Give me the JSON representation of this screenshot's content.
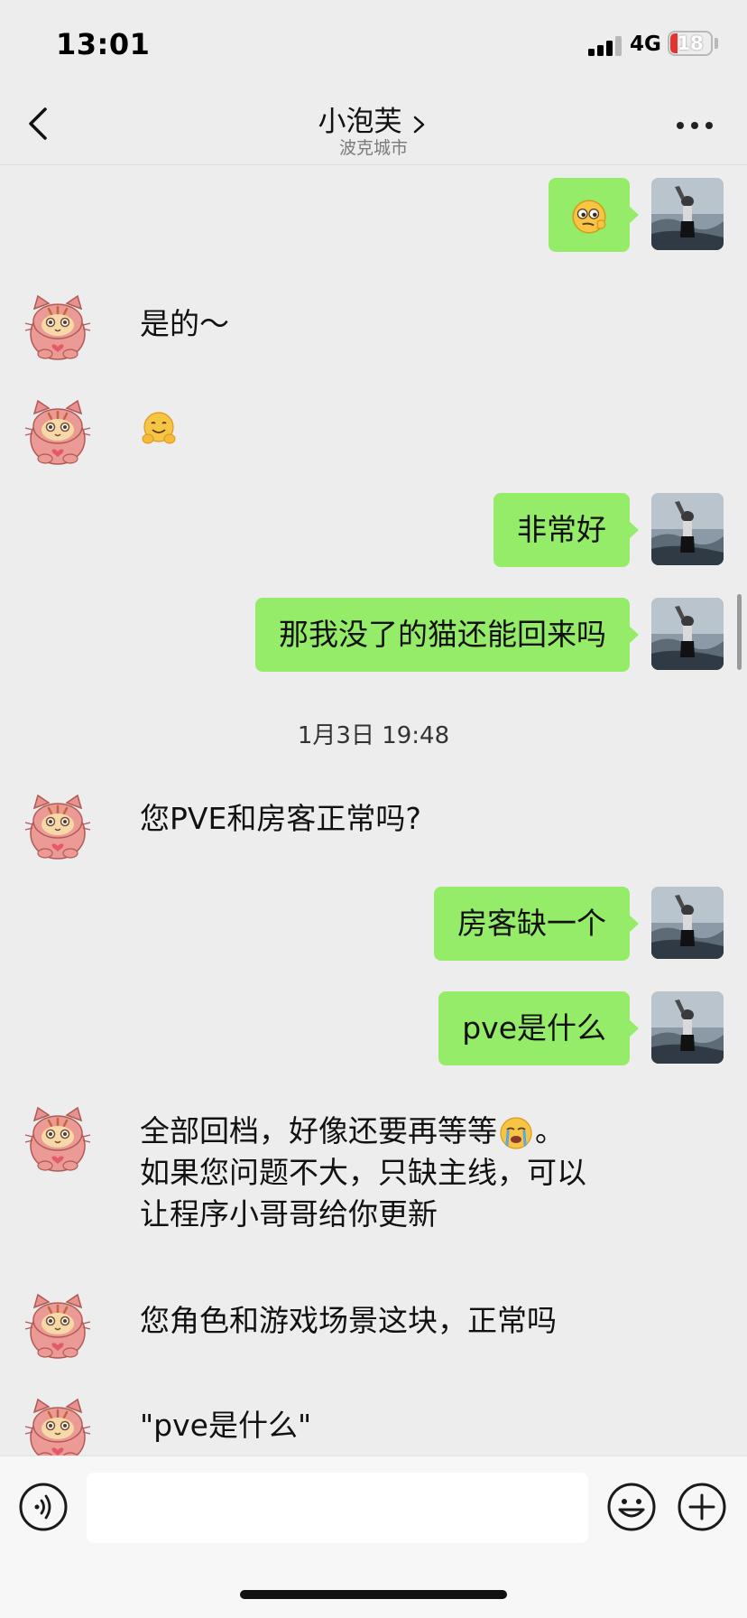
{
  "status": {
    "time": "13:01",
    "network": "4G",
    "battery": "18"
  },
  "header": {
    "title": "小泡芙",
    "subtitle": "波克城市"
  },
  "messages": {
    "m2": "是的～",
    "m4": "非常好",
    "m5": "那我没了的猫还能回来吗",
    "timestamp": "1月3日 19:48",
    "m6": "您PVE和房客正常吗?",
    "m7": "房客缺一个",
    "m8": "pve是什么",
    "m9_line1": "全部回档，好像还要再等等",
    "m9_line1_end": "。",
    "m9_line2": "如果您问题不大，只缺主线，可以",
    "m9_line3": "让程序小哥哥给你更新",
    "m10": "您角色和游戏场景这块，正常吗",
    "m11": "\"pve是什么\""
  },
  "input": {
    "placeholder": ""
  },
  "icons": {
    "back": "chevron-left-icon",
    "more": "more-dots-icon",
    "voice": "voice-icon",
    "emoji": "emoji-face-icon",
    "plus": "plus-circle-icon"
  },
  "colors": {
    "bubble_self": "#95ec69",
    "background": "#ededed"
  }
}
